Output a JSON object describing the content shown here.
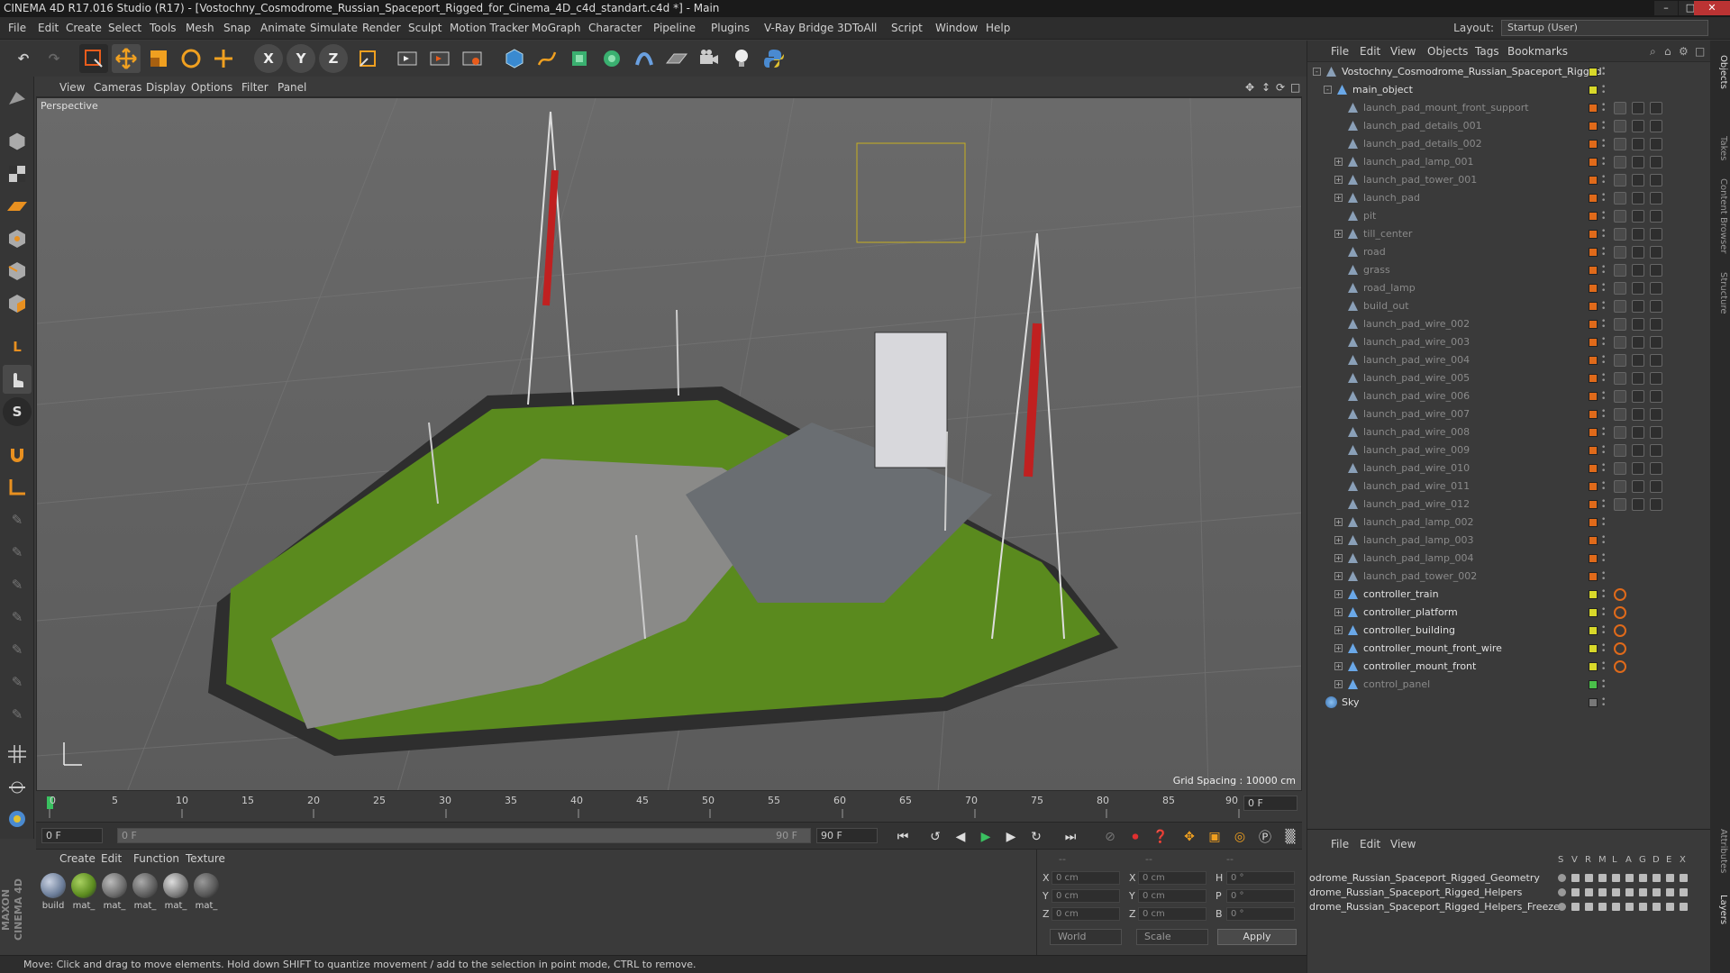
{
  "window": {
    "title": "CINEMA 4D R17.016 Studio (R17) - [Vostochny_Cosmodrome_Russian_Spaceport_Rigged_for_Cinema_4D_c4d_standart.c4d *] - Main",
    "min": "–",
    "max": "□",
    "close": "✕"
  },
  "menu": [
    "File",
    "Edit",
    "Create",
    "Select",
    "Tools",
    "Mesh",
    "Snap",
    "Animate",
    "Simulate",
    "Render",
    "Sculpt",
    "Motion Tracker",
    "MoGraph",
    "Character",
    "Pipeline",
    "Plugins",
    "V-Ray Bridge",
    "3DToAll",
    "Script",
    "Window",
    "Help"
  ],
  "layout": {
    "label": "Layout:",
    "value": "Startup (User)"
  },
  "toolbar": {
    "x": "X",
    "y": "Y",
    "z": "Z"
  },
  "viewport": {
    "menu": [
      "View",
      "Cameras",
      "Display",
      "Options",
      "Filter",
      "Panel"
    ],
    "label": "Perspective",
    "grid_spacing": "Grid Spacing : 10000 cm"
  },
  "timeline": {
    "ticks": [
      "0",
      "5",
      "10",
      "15",
      "20",
      "25",
      "30",
      "35",
      "40",
      "45",
      "50",
      "55",
      "60",
      "65",
      "70",
      "75",
      "80",
      "85",
      "90"
    ],
    "frame_end": "0 F",
    "current": "0 F",
    "range_start": "0 F",
    "range_end": "90 F",
    "max": "90 F"
  },
  "materials": {
    "menu": [
      "Create",
      "Edit",
      "Function",
      "Texture"
    ],
    "items": [
      {
        "label": "build",
        "color": "#6a7c98"
      },
      {
        "label": "mat_",
        "color": "#5a8a1e"
      },
      {
        "label": "mat_",
        "color": "#6a6a6a"
      },
      {
        "label": "mat_",
        "color": "#5c5c5c"
      },
      {
        "label": "mat_",
        "color": "#7a7a7a"
      },
      {
        "label": "mat_",
        "color": "#555"
      }
    ]
  },
  "coords": {
    "hdr1": "--",
    "hdr2": "--",
    "hdr3": "--",
    "x": "X",
    "y": "Y",
    "z": "Z",
    "h": "H",
    "p": "P",
    "b": "B",
    "px": "0 cm",
    "py": "0 cm",
    "pz": "0 cm",
    "sx": "0 cm",
    "sy": "0 cm",
    "sz": "0 cm",
    "rh": "0 °",
    "rp": "0 °",
    "rb": "0 °",
    "world": "World",
    "scale": "Scale",
    "apply": "Apply"
  },
  "status": "Move: Click and drag to move elements. Hold down SHIFT to quantize movement / add to the selection in point mode, CTRL to remove.",
  "object_manager": {
    "menu": [
      "File",
      "Edit",
      "View",
      "Objects",
      "Tags",
      "Bookmarks"
    ],
    "rows": [
      {
        "name": "Vostochny_Cosmodrome_Russian_Spaceport_Rigged",
        "level": 0,
        "exp": "-",
        "dim": false,
        "color": "#d8d82a"
      },
      {
        "name": "main_object",
        "level": 1,
        "exp": "-",
        "dim": false,
        "color": "#d8d82a"
      },
      {
        "name": "launch_pad_mount_front_support",
        "level": 2,
        "exp": "",
        "dim": true,
        "color": "#e06a1a"
      },
      {
        "name": "launch_pad_details_001",
        "level": 2,
        "exp": "",
        "dim": true,
        "color": "#e06a1a"
      },
      {
        "name": "launch_pad_details_002",
        "level": 2,
        "exp": "",
        "dim": true,
        "color": "#e06a1a"
      },
      {
        "name": "launch_pad_lamp_001",
        "level": 2,
        "exp": "+",
        "dim": true,
        "color": "#e06a1a"
      },
      {
        "name": "launch_pad_tower_001",
        "level": 2,
        "exp": "+",
        "dim": true,
        "color": "#e06a1a"
      },
      {
        "name": "launch_pad",
        "level": 2,
        "exp": "+",
        "dim": true,
        "color": "#e06a1a"
      },
      {
        "name": "pit",
        "level": 2,
        "exp": "",
        "dim": true,
        "color": "#e06a1a"
      },
      {
        "name": "till_center",
        "level": 2,
        "exp": "+",
        "dim": true,
        "color": "#e06a1a"
      },
      {
        "name": "road",
        "level": 2,
        "exp": "",
        "dim": true,
        "color": "#e06a1a"
      },
      {
        "name": "grass",
        "level": 2,
        "exp": "",
        "dim": true,
        "color": "#e06a1a"
      },
      {
        "name": "road_lamp",
        "level": 2,
        "exp": "",
        "dim": true,
        "color": "#e06a1a"
      },
      {
        "name": "build_out",
        "level": 2,
        "exp": "",
        "dim": true,
        "color": "#e06a1a"
      },
      {
        "name": "launch_pad_wire_002",
        "level": 2,
        "exp": "",
        "dim": true,
        "color": "#e06a1a"
      },
      {
        "name": "launch_pad_wire_003",
        "level": 2,
        "exp": "",
        "dim": true,
        "color": "#e06a1a"
      },
      {
        "name": "launch_pad_wire_004",
        "level": 2,
        "exp": "",
        "dim": true,
        "color": "#e06a1a"
      },
      {
        "name": "launch_pad_wire_005",
        "level": 2,
        "exp": "",
        "dim": true,
        "color": "#e06a1a"
      },
      {
        "name": "launch_pad_wire_006",
        "level": 2,
        "exp": "",
        "dim": true,
        "color": "#e06a1a"
      },
      {
        "name": "launch_pad_wire_007",
        "level": 2,
        "exp": "",
        "dim": true,
        "color": "#e06a1a"
      },
      {
        "name": "launch_pad_wire_008",
        "level": 2,
        "exp": "",
        "dim": true,
        "color": "#e06a1a"
      },
      {
        "name": "launch_pad_wire_009",
        "level": 2,
        "exp": "",
        "dim": true,
        "color": "#e06a1a"
      },
      {
        "name": "launch_pad_wire_010",
        "level": 2,
        "exp": "",
        "dim": true,
        "color": "#e06a1a"
      },
      {
        "name": "launch_pad_wire_011",
        "level": 2,
        "exp": "",
        "dim": true,
        "color": "#e06a1a"
      },
      {
        "name": "launch_pad_wire_012",
        "level": 2,
        "exp": "",
        "dim": true,
        "color": "#e06a1a"
      },
      {
        "name": "launch_pad_lamp_002",
        "level": 2,
        "exp": "+",
        "dim": true,
        "color": "#e06a1a"
      },
      {
        "name": "launch_pad_lamp_003",
        "level": 2,
        "exp": "+",
        "dim": true,
        "color": "#e06a1a"
      },
      {
        "name": "launch_pad_lamp_004",
        "level": 2,
        "exp": "+",
        "dim": true,
        "color": "#e06a1a"
      },
      {
        "name": "launch_pad_tower_002",
        "level": 2,
        "exp": "+",
        "dim": true,
        "color": "#e06a1a"
      },
      {
        "name": "controller_train",
        "level": 2,
        "exp": "+",
        "dim": false,
        "color": "#d8d82a"
      },
      {
        "name": "controller_platform",
        "level": 2,
        "exp": "+",
        "dim": false,
        "color": "#d8d82a"
      },
      {
        "name": "controller_building",
        "level": 2,
        "exp": "+",
        "dim": false,
        "color": "#d8d82a"
      },
      {
        "name": "controller_mount_front_wire",
        "level": 2,
        "exp": "+",
        "dim": false,
        "color": "#d8d82a"
      },
      {
        "name": "controller_mount_front",
        "level": 2,
        "exp": "+",
        "dim": false,
        "color": "#d8d82a"
      },
      {
        "name": "control_panel",
        "level": 2,
        "exp": "+",
        "dim": true,
        "color": "#4ac04a"
      },
      {
        "name": "Sky",
        "level": 0,
        "exp": "",
        "dim": false,
        "color": "#777"
      }
    ]
  },
  "layer_manager": {
    "menu": [
      "File",
      "Edit",
      "View"
    ],
    "headers": [
      "S",
      "V",
      "R",
      "M",
      "L",
      "A",
      "G",
      "D",
      "E",
      "X"
    ],
    "rows": [
      "odrome_Russian_Spaceport_Rigged_Geometry",
      "drome_Russian_Spaceport_Rigged_Helpers",
      "drome_Russian_Spaceport_Rigged_Helpers_Freeze"
    ]
  },
  "side_tabs": [
    "Objects",
    "Takes",
    "Content Browser",
    "Structure"
  ],
  "side_tabs2": [
    "Attributes",
    "Layers"
  ],
  "brand": "MAXON CINEMA 4D"
}
